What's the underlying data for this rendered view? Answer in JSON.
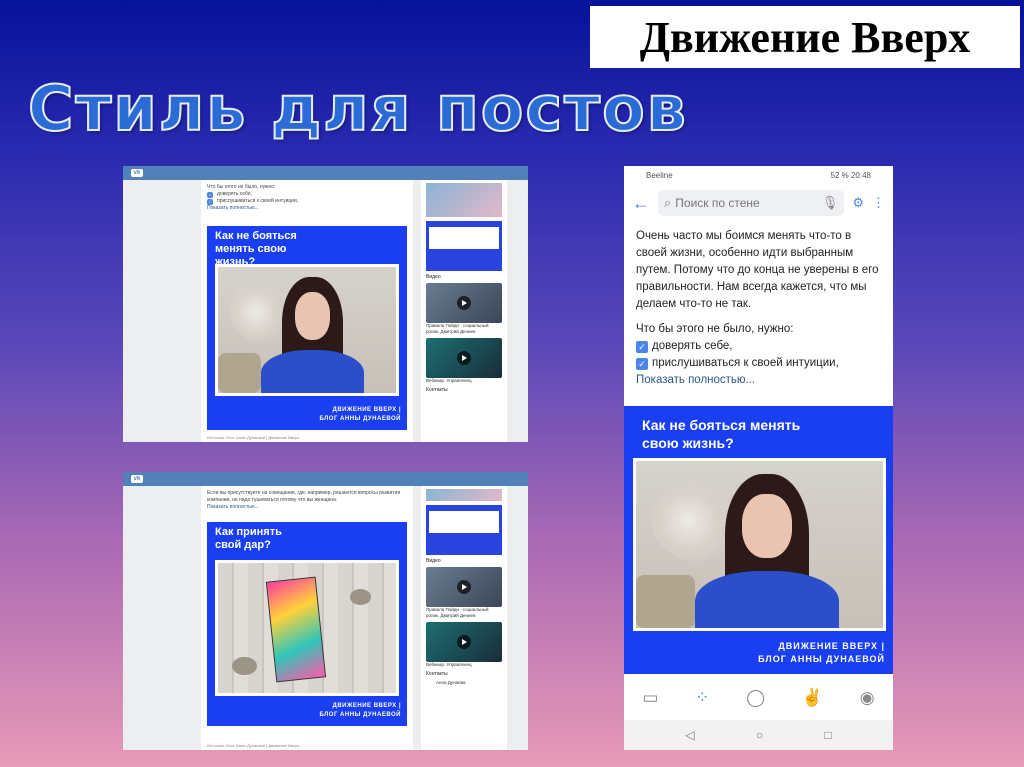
{
  "brand": "Движение Вверх",
  "slide_title": "Стиль для постов",
  "shot1": {
    "intro_lines": [
      "Что бы этого не было, нужно:",
      "доверять себе,",
      "прислушиваться к своей интуиции,"
    ],
    "show_more": "Показать полностью...",
    "card_title": "Как не бояться менять свою жизнь?",
    "sig1": "ДВИЖЕНИЕ ВВЕРХ |",
    "sig2": "БЛОГ АННЫ ДУНАЕВОЙ",
    "source": "Источник: Блог Анны Дунаевой | Движение Вверх",
    "side_video_label": "Видео",
    "side_video_caption": "Правила Пойди - социальный ролик. Дмитрий Дениев",
    "side_video2_caption": "Вебинар. Управленец",
    "side_contacts": "Контакты"
  },
  "shot2": {
    "intro_lines": [
      "Если вы присутствуете на совещании, где, например, решаются вопросы развития",
      "компании, не надо тушеваться потому что вы женщина."
    ],
    "show_more": "Показать полностью...",
    "card_title": "Как принять свой дар?",
    "sig1": "ДВИЖЕНИЕ ВВЕРХ |",
    "sig2": "БЛОГ АННЫ ДУНАЕВОЙ",
    "source": "Источник: Блог Анны Дунаевой | Движение Вверх",
    "side_video_label": "Видео",
    "side_video_caption": "Правила Пойди - социальный ролик. Дмитрий Дениев",
    "side_video2_caption": "Вебинар. Управленец",
    "side_contacts": "Контакты",
    "side_contact_name": "Анна Дунаева"
  },
  "phone": {
    "carrier": "Beeline",
    "status_right": "52 % 20:48",
    "search_placeholder": "Поиск по стене",
    "para1": "Очень часто мы боимся менять что-то в своей жизни, особенно идти выбранным путем. Потому что до конца не уверены в его правильности. Нам всегда кажется, что мы делаем что-то не так.",
    "para2": "Что бы этого не было, нужно:",
    "item1": "доверять себе,",
    "item2": "прислушиваться к своей интуиции,",
    "show_more": "Показать полностью...",
    "card_title": "Как не бояться менять свою жизнь?",
    "sig1": "ДВИЖЕНИЕ ВВЕРХ |",
    "sig2": "БЛОГ АННЫ ДУНАЕВОЙ"
  }
}
